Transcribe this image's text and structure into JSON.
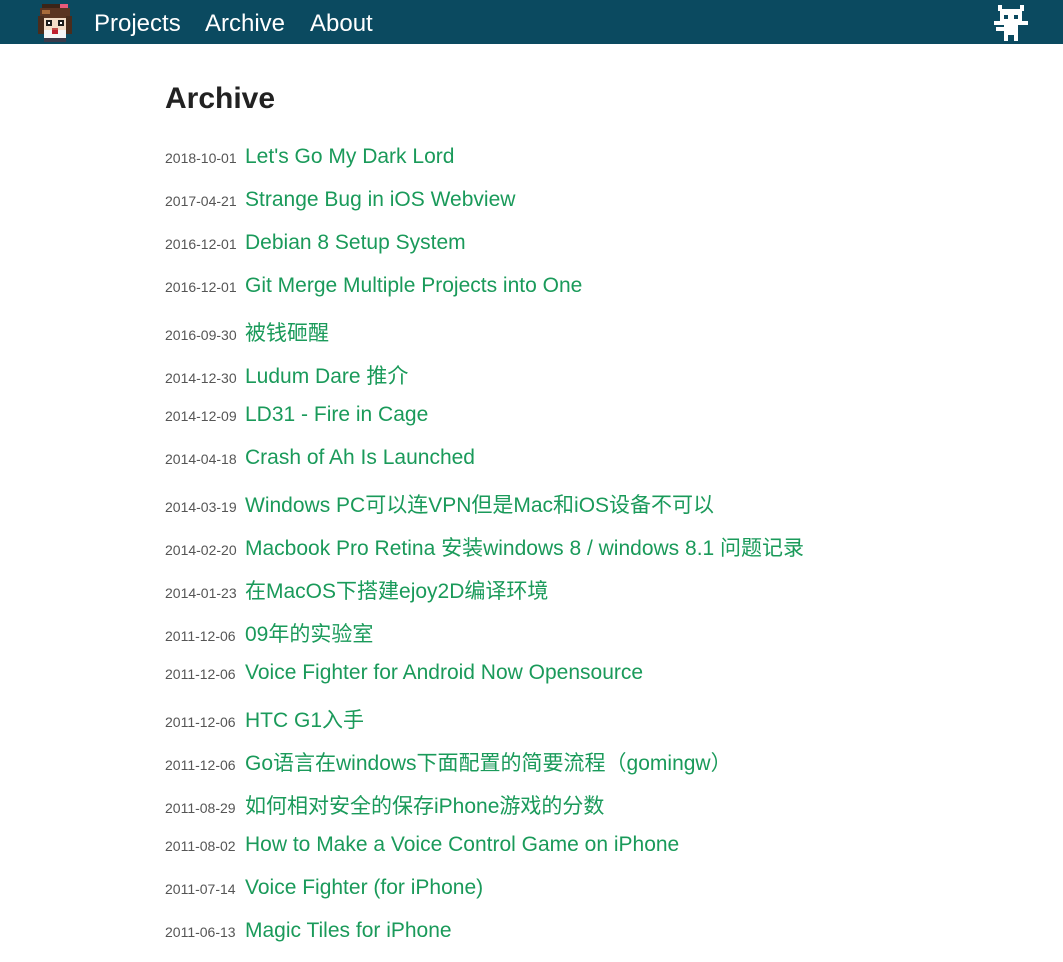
{
  "nav": {
    "links": [
      "Projects",
      "Archive",
      "About"
    ],
    "logo_icon": "pixel-avatar-icon",
    "github_icon": "github-octocat-icon"
  },
  "colors": {
    "header_bg": "#0b4a60",
    "link": "#1a9a5a",
    "title": "#222222",
    "date": "#555555"
  },
  "page": {
    "title": "Archive"
  },
  "posts": [
    {
      "date": "2018-10-01",
      "title": "Let's Go My Dark Lord"
    },
    {
      "date": "2017-04-21",
      "title": "Strange Bug in iOS Webview"
    },
    {
      "date": "2016-12-01",
      "title": "Debian 8 Setup System"
    },
    {
      "date": "2016-12-01",
      "title": "Git Merge Multiple Projects into One"
    },
    {
      "date": "2016-09-30",
      "title": "被钱砸醒"
    },
    {
      "date": "2014-12-30",
      "title": "Ludum Dare 推介"
    },
    {
      "date": "2014-12-09",
      "title": "LD31 - Fire in Cage"
    },
    {
      "date": "2014-04-18",
      "title": "Crash of Ah Is Launched"
    },
    {
      "date": "2014-03-19",
      "title": "Windows PC可以连VPN但是Mac和iOS设备不可以"
    },
    {
      "date": "2014-02-20",
      "title": "Macbook Pro Retina 安装windows 8 / windows 8.1 问题记录"
    },
    {
      "date": "2014-01-23",
      "title": "在MacOS下搭建ejoy2D编译环境"
    },
    {
      "date": "2011-12-06",
      "title": "09年的实验室"
    },
    {
      "date": "2011-12-06",
      "title": "Voice Fighter for Android Now Opensource"
    },
    {
      "date": "2011-12-06",
      "title": "HTC G1入手"
    },
    {
      "date": "2011-12-06",
      "title": "Go语言在windows下面配置的简要流程（gomingw）"
    },
    {
      "date": "2011-08-29",
      "title": "如何相对安全的保存iPhone游戏的分数"
    },
    {
      "date": "2011-08-02",
      "title": "How to Make a Voice Control Game on iPhone"
    },
    {
      "date": "2011-07-14",
      "title": "Voice Fighter (for iPhone)"
    },
    {
      "date": "2011-06-13",
      "title": "Magic Tiles for iPhone"
    }
  ]
}
